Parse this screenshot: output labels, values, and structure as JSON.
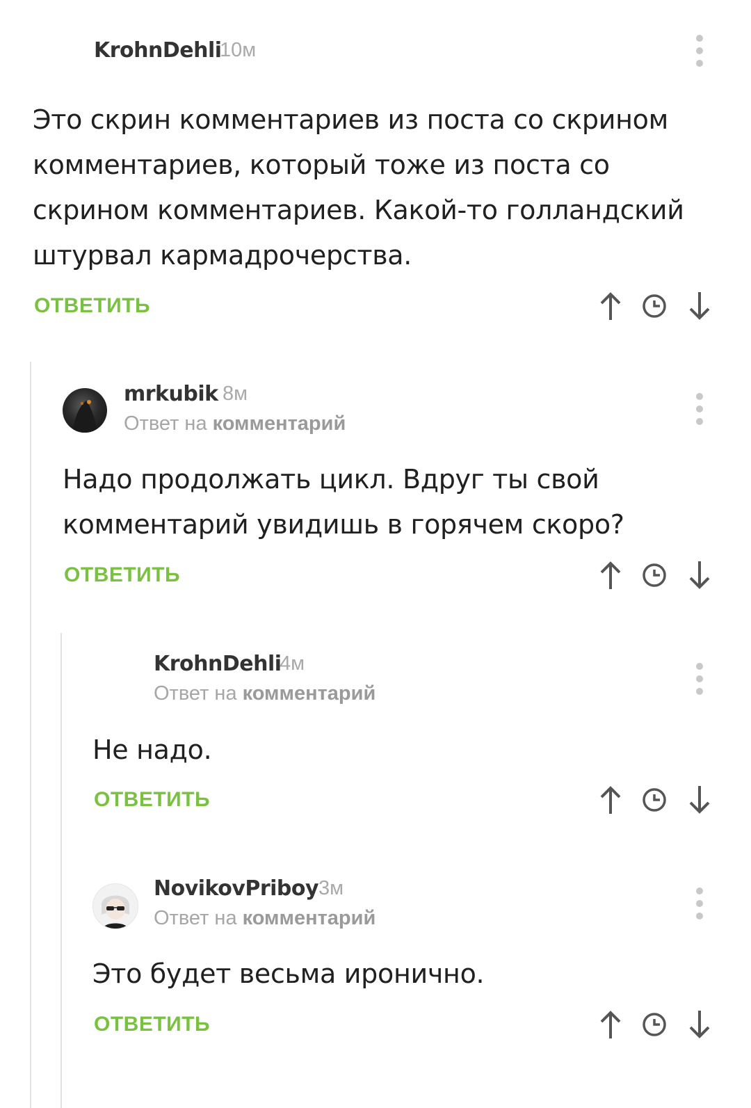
{
  "comments": [
    {
      "author": "KrohnDehli",
      "time": "10м",
      "text": "Это скрин комментариев из поста со скрином комментариев, который тоже из поста со скрином комментариев. Какой-то голландский штурвал кармадрочерства.",
      "reply_label": "ОТВЕТИТЬ"
    },
    {
      "author": "mrkubik",
      "time": "8м",
      "reply_prefix": "Ответ на",
      "reply_link": "комментарий",
      "text": "Надо продолжать цикл. Вдруг ты свой комментарий увидишь в горячем скоро?",
      "reply_label": "ОТВЕТИТЬ"
    },
    {
      "author": "KrohnDehli",
      "time": "4м",
      "reply_prefix": "Ответ на",
      "reply_link": "комментарий",
      "text": "Не надо.",
      "reply_label": "ОТВЕТИТЬ"
    },
    {
      "author": "NovikovPriboy",
      "time": "3м",
      "reply_prefix": "Ответ на",
      "reply_link": "комментарий",
      "text": "Это будет весьма иронично.",
      "reply_label": "ОТВЕТИТЬ"
    }
  ],
  "icons": [
    "more-vertical-icon",
    "arrow-up-icon",
    "clock-icon",
    "arrow-down-icon"
  ],
  "colors": {
    "accent": "#7ac142",
    "muted": "#a9a9a9",
    "thread_line": "#e2e2e2"
  }
}
